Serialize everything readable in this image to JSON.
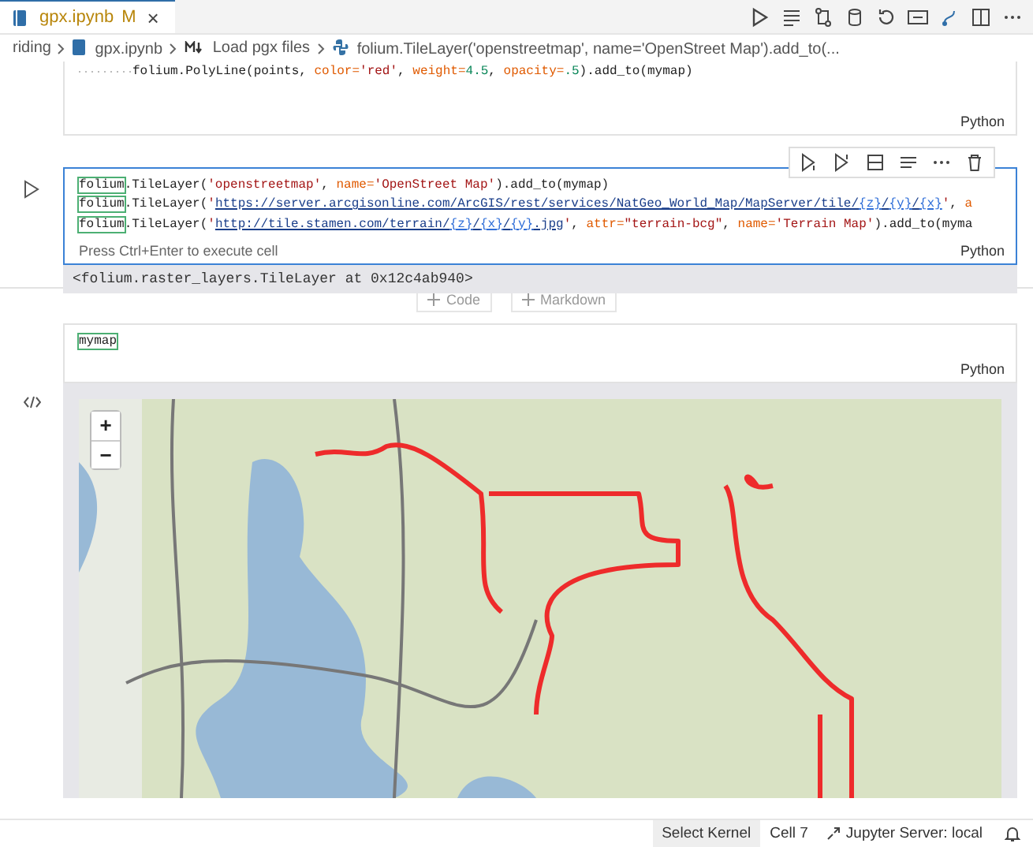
{
  "tab": {
    "label": "gpx.ipynb",
    "badge": "M",
    "close": "×",
    "selected": true
  },
  "breadcrumb": [
    {
      "kind": "folder",
      "label": "riding"
    },
    {
      "kind": "notebook",
      "label": "gpx.ipynb"
    },
    {
      "kind": "markdown",
      "label": "Load pgx files"
    },
    {
      "kind": "python",
      "label": "folium.TileLayer('openstreetmap', name='OpenStreet Map').add_to(..."
    }
  ],
  "cells": [
    {
      "selected": false,
      "indent": true,
      "language": "Python",
      "lines": [
        [
          {
            "kind": "plain",
            "text": "folium.PolyLine(points, "
          },
          {
            "kind": "param",
            "text": "color="
          },
          {
            "kind": "string",
            "text": "'red'"
          },
          {
            "kind": "plain",
            "text": ", "
          },
          {
            "kind": "param",
            "text": "weight="
          },
          {
            "kind": "number",
            "text": "4.5"
          },
          {
            "kind": "plain",
            "text": ", "
          },
          {
            "kind": "param",
            "text": "opacity="
          },
          {
            "kind": "number",
            "text": ".5"
          },
          {
            "kind": "plain",
            "text": ").add_to(mymap)"
          }
        ]
      ]
    },
    {
      "selected": true,
      "indent": false,
      "language": "Python",
      "hint": "Press Ctrl+Enter to execute cell",
      "output": "<folium.raster_layers.TileLayer at 0x12c4ab940>",
      "lines": [
        [
          {
            "kind": "match",
            "text": "folium"
          },
          {
            "kind": "plain",
            "text": ".TileLayer("
          },
          {
            "kind": "string",
            "text": "'openstreetmap'"
          },
          {
            "kind": "plain",
            "text": ", "
          },
          {
            "kind": "param",
            "text": "name="
          },
          {
            "kind": "string",
            "text": "'OpenStreet Map'"
          },
          {
            "kind": "plain",
            "text": ").add_to(mymap)"
          }
        ],
        [
          {
            "kind": "match",
            "text": "folium"
          },
          {
            "kind": "plain",
            "text": ".TileLayer("
          },
          {
            "kind": "string",
            "text": "'"
          },
          {
            "kind": "url",
            "text": "https://server.arcgisonline.com/ArcGIS/rest/services/NatGeo_World_Map/MapServer/tile/"
          },
          {
            "kind": "placeholder",
            "text": "{z}"
          },
          {
            "kind": "url",
            "text": "/"
          },
          {
            "kind": "placeholder",
            "text": "{y}"
          },
          {
            "kind": "url",
            "text": "/"
          },
          {
            "kind": "placeholder",
            "text": "{x}"
          },
          {
            "kind": "string",
            "text": "'"
          },
          {
            "kind": "plain",
            "text": ", "
          },
          {
            "kind": "param",
            "text": "a"
          }
        ],
        [
          {
            "kind": "match",
            "text": "folium"
          },
          {
            "kind": "plain",
            "text": ".TileLayer("
          },
          {
            "kind": "string",
            "text": "'"
          },
          {
            "kind": "url",
            "text": "http://tile.stamen.com/terrain/"
          },
          {
            "kind": "placeholder",
            "text": "{z}"
          },
          {
            "kind": "url",
            "text": "/"
          },
          {
            "kind": "placeholder",
            "text": "{x}"
          },
          {
            "kind": "url",
            "text": "/"
          },
          {
            "kind": "placeholder",
            "text": "{y}"
          },
          {
            "kind": "url",
            "text": ".jpg"
          },
          {
            "kind": "string",
            "text": "'"
          },
          {
            "kind": "plain",
            "text": ", "
          },
          {
            "kind": "param",
            "text": "attr="
          },
          {
            "kind": "string",
            "text": "\"terrain-bcg\""
          },
          {
            "kind": "plain",
            "text": ", "
          },
          {
            "kind": "param",
            "text": "name="
          },
          {
            "kind": "string",
            "text": "'Terrain Map'"
          },
          {
            "kind": "plain",
            "text": ").add_to(myma"
          }
        ]
      ]
    },
    {
      "selected": false,
      "indent": false,
      "language": "Python",
      "map": {
        "zoom_in": "+",
        "zoom_out": "−"
      },
      "lines": [
        [
          {
            "kind": "match",
            "text": "mymap"
          }
        ]
      ]
    }
  ],
  "add_buttons": [
    "Code",
    "Markdown"
  ],
  "status_bar": [
    "Select Kernel",
    "Cell 7",
    "Jupyter Server: local"
  ]
}
